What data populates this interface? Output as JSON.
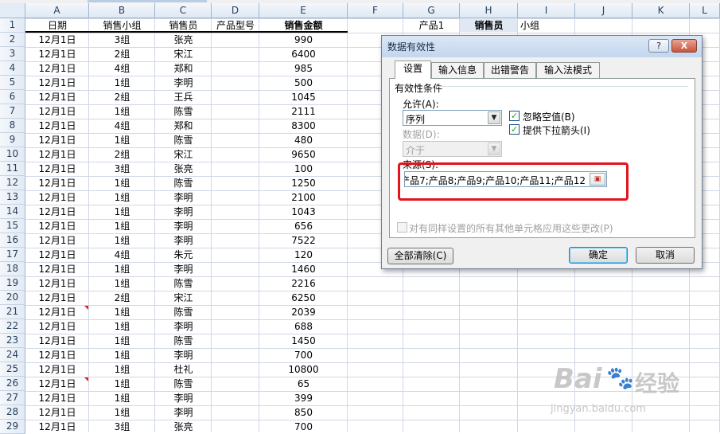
{
  "columns": [
    "A",
    "B",
    "C",
    "D",
    "E",
    "F",
    "G",
    "H",
    "I",
    "J",
    "K",
    "L"
  ],
  "header_row": {
    "A": "日期",
    "B": "销售小组",
    "C": "销售员",
    "D": "产品型号",
    "E": "销售金额",
    "G": "产品1",
    "H": "销售员",
    "I": "小组"
  },
  "rows": [
    {
      "num": "2",
      "A": "12月1日",
      "B": "3组",
      "C": "张亮",
      "E": "990"
    },
    {
      "num": "3",
      "A": "12月1日",
      "B": "2组",
      "C": "宋江",
      "E": "6400"
    },
    {
      "num": "4",
      "A": "12月1日",
      "B": "4组",
      "C": "郑和",
      "E": "985"
    },
    {
      "num": "5",
      "A": "12月1日",
      "B": "1组",
      "C": "李明",
      "E": "500"
    },
    {
      "num": "6",
      "A": "12月1日",
      "B": "2组",
      "C": "王兵",
      "E": "1045"
    },
    {
      "num": "7",
      "A": "12月1日",
      "B": "1组",
      "C": "陈雪",
      "E": "2111"
    },
    {
      "num": "8",
      "A": "12月1日",
      "B": "4组",
      "C": "郑和",
      "E": "8300"
    },
    {
      "num": "9",
      "A": "12月1日",
      "B": "1组",
      "C": "陈雪",
      "E": "480"
    },
    {
      "num": "10",
      "A": "12月1日",
      "B": "2组",
      "C": "宋江",
      "E": "9650"
    },
    {
      "num": "11",
      "A": "12月1日",
      "B": "3组",
      "C": "张亮",
      "E": "100"
    },
    {
      "num": "12",
      "A": "12月1日",
      "B": "1组",
      "C": "陈雪",
      "E": "1250"
    },
    {
      "num": "13",
      "A": "12月1日",
      "B": "1组",
      "C": "李明",
      "E": "2100"
    },
    {
      "num": "14",
      "A": "12月1日",
      "B": "1组",
      "C": "李明",
      "E": "1043"
    },
    {
      "num": "15",
      "A": "12月1日",
      "B": "1组",
      "C": "李明",
      "E": "656"
    },
    {
      "num": "16",
      "A": "12月1日",
      "B": "1组",
      "C": "李明",
      "E": "7522"
    },
    {
      "num": "17",
      "A": "12月1日",
      "B": "4组",
      "C": "朱元",
      "E": "120"
    },
    {
      "num": "18",
      "A": "12月1日",
      "B": "1组",
      "C": "李明",
      "E": "1460"
    },
    {
      "num": "19",
      "A": "12月1日",
      "B": "1组",
      "C": "陈雪",
      "E": "2216"
    },
    {
      "num": "20",
      "A": "12月1日",
      "B": "2组",
      "C": "宋江",
      "E": "6250"
    },
    {
      "num": "21",
      "A": "12月1日",
      "B": "1组",
      "C": "陈雪",
      "E": "2039"
    },
    {
      "num": "22",
      "A": "12月1日",
      "B": "1组",
      "C": "李明",
      "E": "688"
    },
    {
      "num": "23",
      "A": "12月1日",
      "B": "1组",
      "C": "陈雪",
      "E": "1450"
    },
    {
      "num": "24",
      "A": "12月1日",
      "B": "1组",
      "C": "李明",
      "E": "700"
    },
    {
      "num": "25",
      "A": "12月1日",
      "B": "1组",
      "C": "杜礼",
      "E": "10800"
    },
    {
      "num": "26",
      "A": "12月1日",
      "B": "1组",
      "C": "陈雪",
      "E": "65"
    },
    {
      "num": "27",
      "A": "12月1日",
      "B": "1组",
      "C": "李明",
      "E": "399"
    },
    {
      "num": "28",
      "A": "12月1日",
      "B": "1组",
      "C": "李明",
      "E": "850"
    },
    {
      "num": "29",
      "A": "12月1日",
      "B": "3组",
      "C": "张亮",
      "E": "700"
    }
  ],
  "comment_marker_rows": [
    "21",
    "26"
  ],
  "dialog": {
    "title": "数据有效性",
    "help_label": "?",
    "close_label": "X",
    "tabs": [
      "设置",
      "输入信息",
      "出错警告",
      "输入法模式"
    ],
    "group_label": "有效性条件",
    "allow_label": "允许(A):",
    "allow_value": "序列",
    "data_label": "数据(D):",
    "data_value": "介于",
    "ignore_blank_label": "忽略空值(B)",
    "dropdown_label": "提供下拉箭头(I)",
    "check_mark": "✓",
    "source_label": "来源(S):",
    "source_value": "产品7;产品8;产品9;产品10;产品11;产品12",
    "apply_all_label": "对有同样设置的所有其他单元格应用这些更改(P)",
    "clear_all_label": "全部清除(C)",
    "ok_label": "确定",
    "cancel_label": "取消"
  },
  "watermark": {
    "brand": "Bai",
    "paw": "🐾",
    "suffix": "经验",
    "url": "jingyan.baidu.com"
  },
  "colors": {
    "highlight_border": "#e3141d",
    "header_blue": "#dfe8f3"
  }
}
